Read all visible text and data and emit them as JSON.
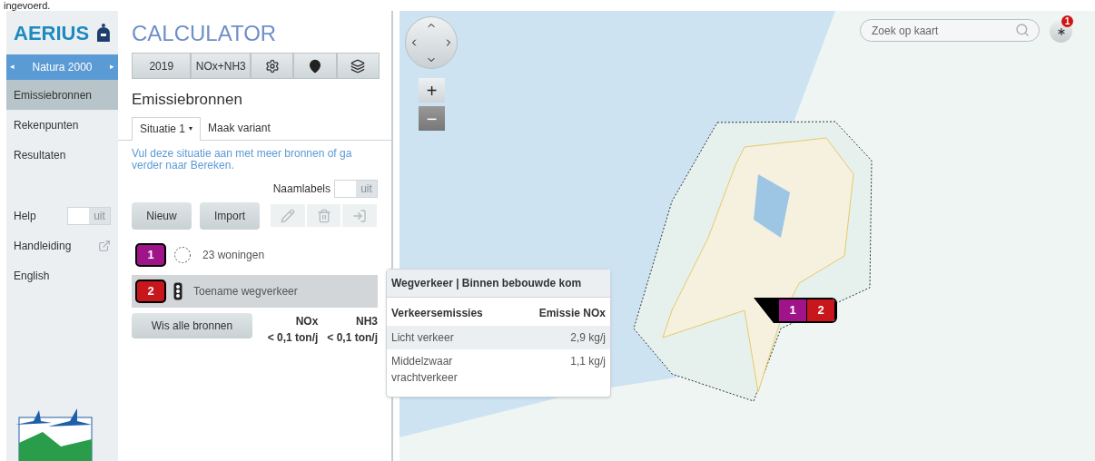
{
  "caption": "ingevoerd.",
  "sidebar": {
    "logo": "AERIUS",
    "context": {
      "label": "Natura 2000",
      "prev": "◂",
      "next": "▸"
    },
    "items": [
      {
        "label": "Emissiebronnen",
        "selected": true
      },
      {
        "label": "Rekenpunten",
        "selected": false
      },
      {
        "label": "Resultaten",
        "selected": false
      }
    ],
    "help": {
      "label": "Help",
      "toggle": {
        "on": false,
        "label": "uit"
      }
    },
    "links": [
      {
        "label": "Handleiding",
        "kind": "external"
      },
      {
        "label": "English",
        "kind": "plain"
      }
    ]
  },
  "panel": {
    "title": "CALCULATOR",
    "toolbar": [
      {
        "kind": "text",
        "label": "2019"
      },
      {
        "kind": "text",
        "label": "NOx+NH3"
      },
      {
        "kind": "gear"
      },
      {
        "kind": "pin"
      },
      {
        "kind": "layers"
      }
    ],
    "heading": "Emissiebronnen",
    "tabs": [
      {
        "label": "Situatie 1",
        "caret": "▾",
        "selected": true
      },
      {
        "label": "Maak variant",
        "selected": false
      }
    ],
    "info": "Vul deze situatie aan met meer bronnen of ga verder naar Bereken.",
    "name_labels": {
      "label": "Naamlabels",
      "on": false,
      "state": "uit"
    },
    "actions": [
      {
        "label": "Nieuw"
      },
      {
        "label": "Import"
      }
    ],
    "tools": [
      {
        "kind": "edit",
        "disabled": true
      },
      {
        "kind": "trash",
        "disabled": true
      },
      {
        "kind": "export",
        "disabled": true
      }
    ],
    "sources": [
      {
        "number": "1",
        "color": "#a0148a",
        "kind": "area",
        "label": "23 woningen",
        "selected": false
      },
      {
        "number": "2",
        "color": "#c8161d",
        "kind": "traffic",
        "label": "Toename wegverkeer",
        "selected": true
      }
    ],
    "clear_button": "Wis alle bronnen",
    "totals": [
      {
        "label": "NOx",
        "value": "< 0,1 ton/j"
      },
      {
        "label": "NH3",
        "value": "< 0,1 ton/j"
      }
    ]
  },
  "tooltip": {
    "title": "Wegverkeer | Binnen bebouwde kom",
    "columns": [
      "Verkeersemissies",
      "Emissie NOx"
    ],
    "rows": [
      {
        "label": "Licht verkeer",
        "value": "2,9 kg/j"
      },
      {
        "label": "Middelzwaar vrachtverkeer",
        "value": "1,1 kg/j"
      }
    ]
  },
  "map": {
    "zoom_in": "+",
    "zoom_out": "−",
    "search": {
      "placeholder": "Zoek op kaart"
    },
    "notification_count": "1",
    "marker": [
      {
        "number": "1",
        "color": "#a0148a"
      },
      {
        "number": "2",
        "color": "#c8161d"
      }
    ]
  }
}
